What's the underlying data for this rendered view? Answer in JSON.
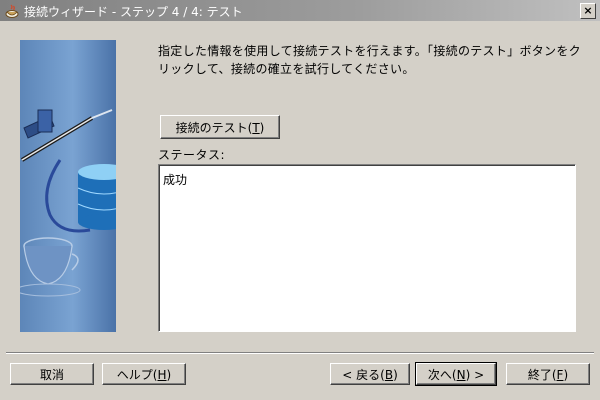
{
  "window": {
    "title": "接続ウィザード - ステップ 4 / 4: テスト",
    "close_glyph": "×"
  },
  "main": {
    "instructions": "指定した情報を使用して接続テストを行えます。「接続のテスト」ボタンをクリックして、接続の確立を試行してください。",
    "test_button": {
      "label": "接続のテスト",
      "mnemonic": "T"
    },
    "status_label": "ステータス:",
    "status_value": "成功"
  },
  "footer": {
    "cancel": {
      "label": "取消"
    },
    "help": {
      "label": "ヘルプ",
      "mnemonic": "H"
    },
    "back": {
      "prefix": "< ",
      "label": "戻る",
      "mnemonic": "B"
    },
    "next": {
      "label": "次へ",
      "mnemonic": "N",
      "suffix": " >"
    },
    "finish": {
      "label": "終了",
      "mnemonic": "F"
    }
  },
  "icons": {
    "app_icon": "java-cup-icon",
    "side_art": "database-connection-illustration"
  }
}
